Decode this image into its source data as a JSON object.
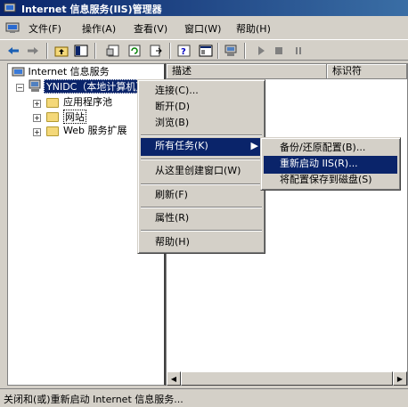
{
  "window": {
    "title": "Internet 信息服务(IIS)管理器"
  },
  "menubar": {
    "items": [
      "文件(F)",
      "操作(A)",
      "查看(V)",
      "窗口(W)",
      "帮助(H)"
    ]
  },
  "tree": {
    "root": "Internet 信息服务",
    "computer": "YNIDC（本地计算机）",
    "children": [
      "应用程序池",
      "网站",
      "Web 服务扩展"
    ]
  },
  "list": {
    "columns": [
      "描述",
      "标识符"
    ]
  },
  "context_menu": {
    "items": [
      "连接(C)...",
      "断开(D)",
      "浏览(B)",
      "所有任务(K)",
      "从这里创建窗口(W)",
      "刷新(F)",
      "属性(R)",
      "帮助(H)"
    ]
  },
  "submenu": {
    "items": [
      "备份/还原配置(B)...",
      "重新启动 IIS(R)...",
      "将配置保存到磁盘(S)"
    ]
  },
  "status": {
    "text": "关闭和(或)重新启动 Internet 信息服务..."
  },
  "colors": {
    "title_start": "#0a246a",
    "title_end": "#3a6ea5",
    "selection": "#0a246a",
    "face": "#d4d0c8"
  },
  "icons": {
    "title": "iis-icon",
    "menubar": "iis-icon",
    "toolbar": [
      "back-arrow-icon",
      "forward-arrow-icon",
      "up-folder-icon",
      "show-tree-icon",
      "properties-icon",
      "refresh-icon",
      "export-icon",
      "help-icon",
      "show-console-icon",
      "computer-icon",
      "play-icon",
      "stop-icon",
      "pause-icon"
    ]
  }
}
